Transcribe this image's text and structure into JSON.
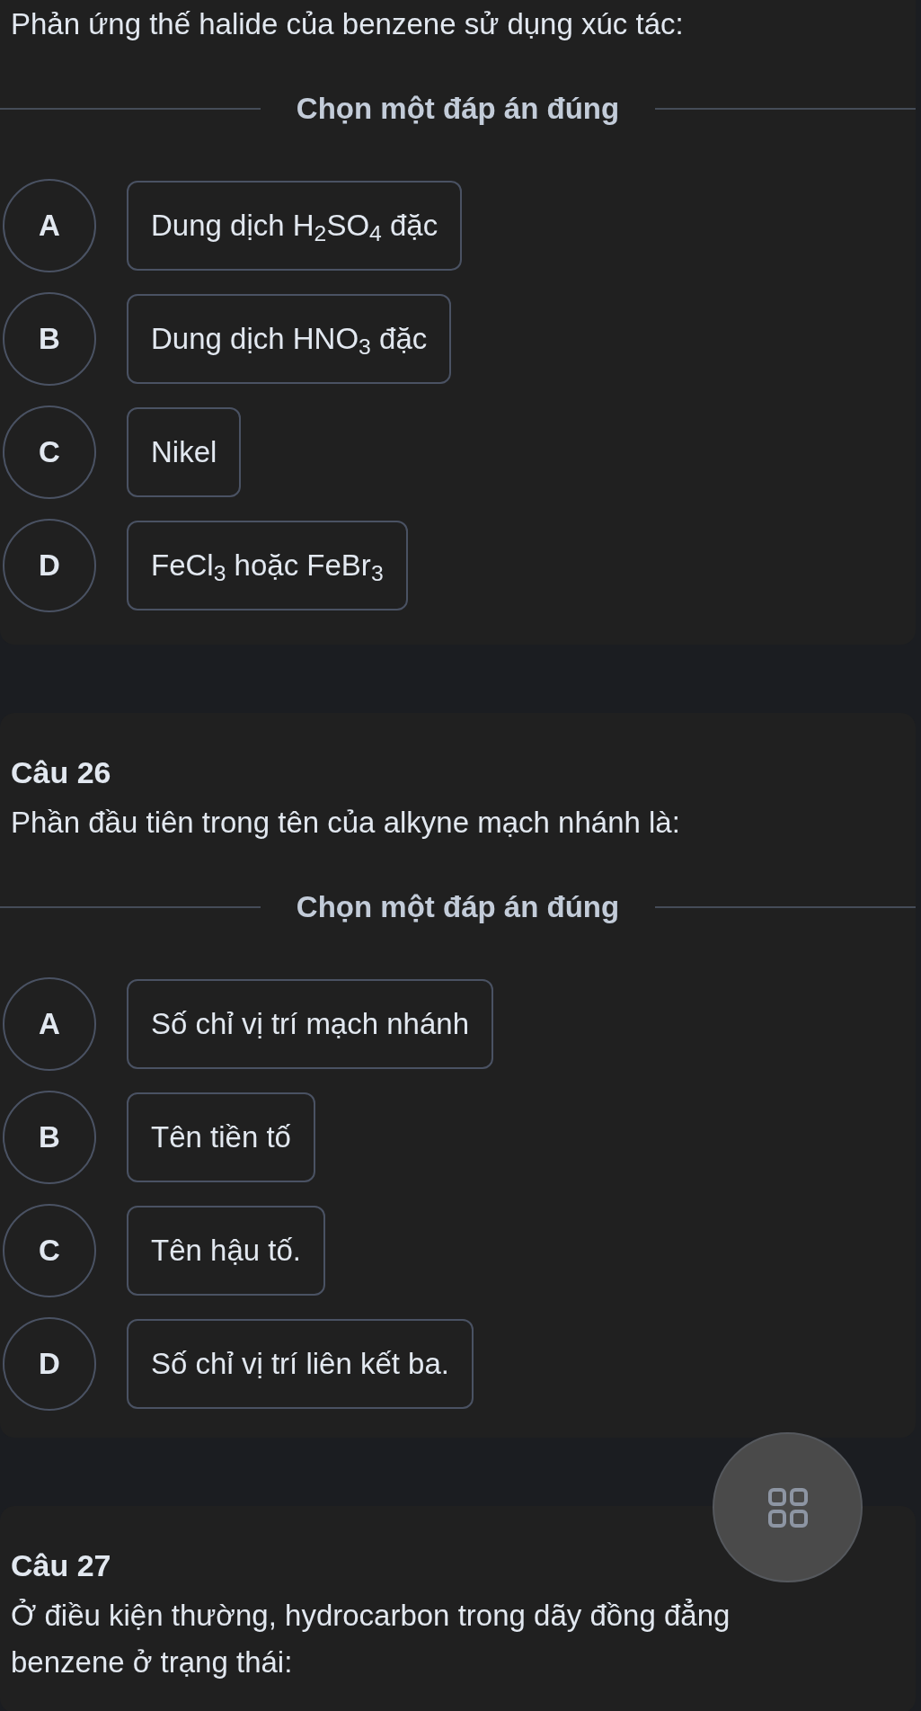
{
  "questions": [
    {
      "prompt": "Phản ứng thế halide của benzene sử dụng xúc tác:",
      "instruction": "Chọn một đáp án đúng",
      "options": [
        {
          "letter": "A",
          "text": "Dung dịch H$_{2}$SO$_{4}$ đặc",
          "selected": false
        },
        {
          "letter": "B",
          "text": "Dung dịch HNO$_{3}$ đặc",
          "selected": false
        },
        {
          "letter": "C",
          "text": "Nikel",
          "selected": false
        },
        {
          "letter": "D",
          "text": "FeCl$_{3}$ hoặc FeBr$_{3}$",
          "selected": false
        }
      ]
    },
    {
      "number": "Câu 26",
      "prompt": "Phần đầu tiên trong tên của alkyne mạch nhánh là:",
      "instruction": "Chọn một đáp án đúng",
      "options": [
        {
          "letter": "A",
          "text": "Số chỉ vị trí mạch nhánh",
          "selected": false
        },
        {
          "letter": "B",
          "text": "Tên tiền tố",
          "selected": false
        },
        {
          "letter": "C",
          "text": "Tên hậu tố.",
          "selected": false
        },
        {
          "letter": "D",
          "text": "Số chỉ vị trí liên kết ba.",
          "selected": false
        }
      ]
    },
    {
      "number": "Câu 27",
      "prompt": "Ở điều kiện thường, hydrocarbon trong dãy đồng đẳng benzene ở trạng thái:"
    }
  ]
}
